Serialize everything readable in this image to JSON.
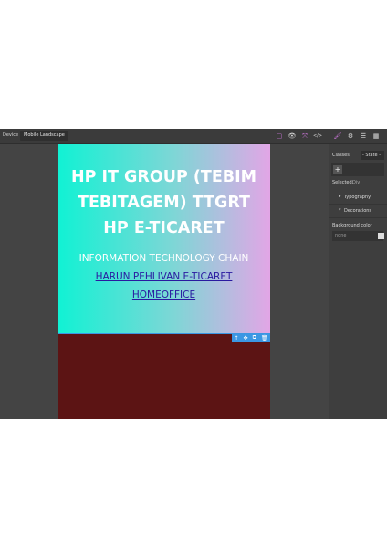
{
  "topbar": {
    "device_label": "Device",
    "device_value": "Mobile Landscape"
  },
  "toolbar_icons": [
    {
      "name": "sw-visibility-icon",
      "glyph": "▢"
    },
    {
      "name": "preview-icon",
      "glyph": "👁"
    },
    {
      "name": "fullscreen-icon",
      "glyph": "⤧"
    },
    {
      "name": "export-code-icon",
      "glyph": "</>"
    },
    {
      "name": "style-manager-icon",
      "glyph": "🖌"
    },
    {
      "name": "settings-icon",
      "glyph": "⚙"
    },
    {
      "name": "layer-manager-icon",
      "glyph": "☰"
    },
    {
      "name": "blocks-icon",
      "glyph": "▦"
    }
  ],
  "hero": {
    "title": "HP IT GROUP (TEBIM TEBITAGEM) TTGRT HP E-TICARET",
    "subtitle": "INFORMATION TECHNOLOGY CHAIN",
    "link1": "HARUN PEHLIVAN E-TICARET",
    "link2": "HOMEOFFICE"
  },
  "badge_icons": [
    "↑",
    "✥",
    "⧉",
    "🗑"
  ],
  "panel": {
    "classes_label": "Classes",
    "state_value": "- State -",
    "add_glyph": "+",
    "selected_label": "Selected:",
    "selected_value": "Div",
    "typography": "Typography",
    "decorations": "Decorations",
    "bg_label": "Background color",
    "bg_placeholder": "none"
  },
  "colors": {
    "editor_bg": "#444444",
    "frame_bg": "#5c1414",
    "accent": "#3b97e3",
    "active_icon": "#d178e0"
  }
}
